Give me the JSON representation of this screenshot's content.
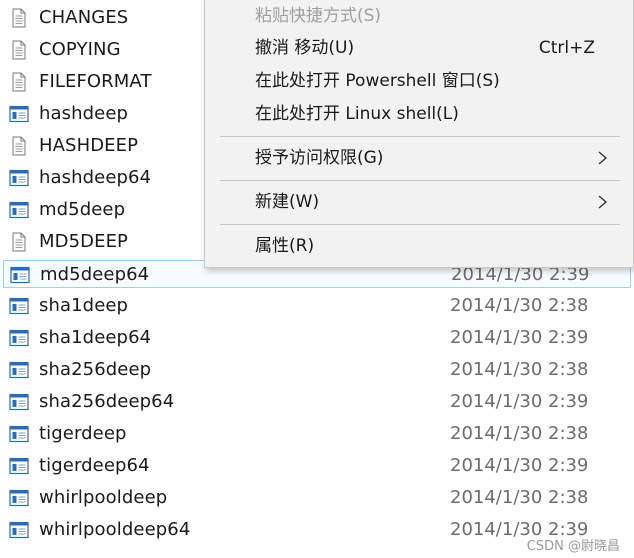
{
  "files": [
    {
      "name": "CHANGES",
      "icon": "text-file-icon",
      "date": ""
    },
    {
      "name": "COPYING",
      "icon": "text-file-icon",
      "date": ""
    },
    {
      "name": "FILEFORMAT",
      "icon": "text-file-icon",
      "date": ""
    },
    {
      "name": "hashdeep",
      "icon": "executable-icon",
      "date": ""
    },
    {
      "name": "HASHDEEP",
      "icon": "text-file-icon",
      "date": ""
    },
    {
      "name": "hashdeep64",
      "icon": "executable-icon",
      "date": ""
    },
    {
      "name": "md5deep",
      "icon": "executable-icon",
      "date": ""
    },
    {
      "name": "MD5DEEP",
      "icon": "text-file-icon",
      "date": ""
    },
    {
      "name": "md5deep64",
      "icon": "executable-icon",
      "date": "2014/1/30 2:39",
      "selected": true
    },
    {
      "name": "sha1deep",
      "icon": "executable-icon",
      "date": "2014/1/30 2:38"
    },
    {
      "name": "sha1deep64",
      "icon": "executable-icon",
      "date": "2014/1/30 2:39"
    },
    {
      "name": "sha256deep",
      "icon": "executable-icon",
      "date": "2014/1/30 2:38"
    },
    {
      "name": "sha256deep64",
      "icon": "executable-icon",
      "date": "2014/1/30 2:39"
    },
    {
      "name": "tigerdeep",
      "icon": "executable-icon",
      "date": "2014/1/30 2:38"
    },
    {
      "name": "tigerdeep64",
      "icon": "executable-icon",
      "date": "2014/1/30 2:39"
    },
    {
      "name": "whirlpooldeep",
      "icon": "executable-icon",
      "date": "2014/1/30 2:38"
    },
    {
      "name": "whirlpooldeep64",
      "icon": "executable-icon",
      "date": "2014/1/30 2:39"
    }
  ],
  "context_menu": {
    "paste_shortcut": "粘贴快捷方式(S)",
    "undo_move": "撤消 移动(U)",
    "undo_shortcut": "Ctrl+Z",
    "open_powershell": "在此处打开 Powershell 窗口(S)",
    "open_linux_shell": "在此处打开 Linux shell(L)",
    "grant_access": "授予访问权限(G)",
    "new": "新建(W)",
    "properties": "属性(R)"
  },
  "watermark": "CSDN @尉晓昌",
  "colors": {
    "selection_border": "#99d1ff",
    "menu_background": "#f2f2f2",
    "date_text": "#6d6d6d"
  }
}
